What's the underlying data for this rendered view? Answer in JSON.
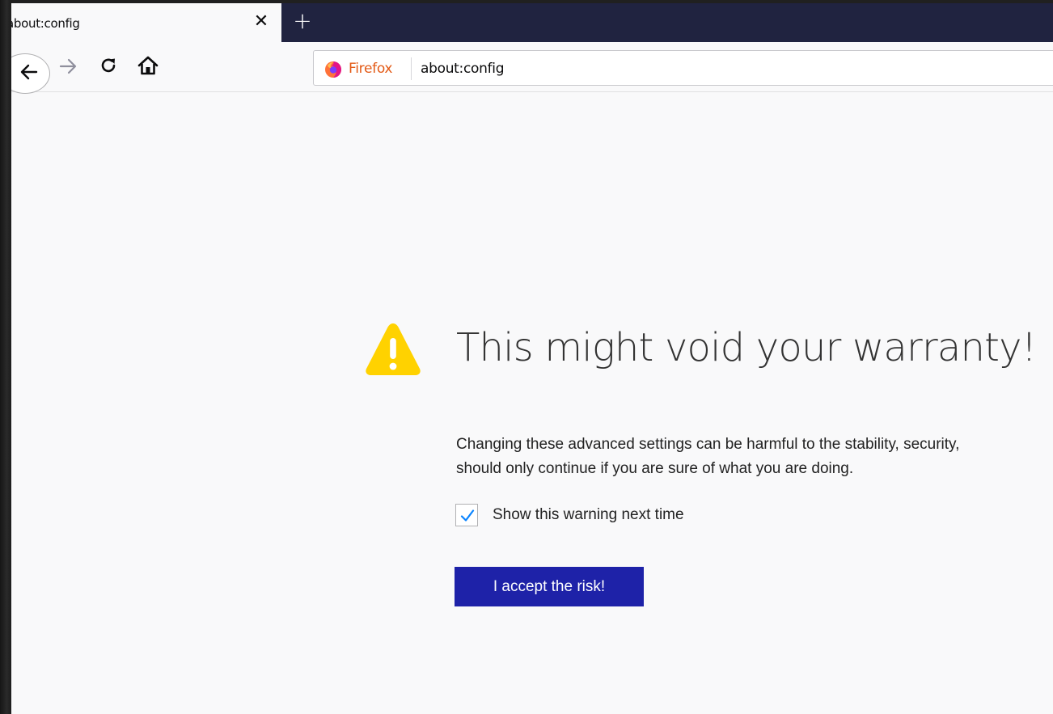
{
  "tab": {
    "title": "about:config",
    "close_glyph": "✕",
    "new_tab_glyph": "+"
  },
  "navbar": {
    "back_icon": "arrow-left-icon",
    "forward_icon": "arrow-right-icon",
    "reload_icon": "reload-icon",
    "home_icon": "home-icon"
  },
  "urlbar": {
    "identity_label": "Firefox",
    "url": "about:config"
  },
  "content": {
    "heading": "This might void your warranty!",
    "description_lines": [
      "Changing these advanced settings can be harmful to the stability, security,",
      "should only continue if you are sure of what you are doing."
    ],
    "checkbox_label": "Show this warning next time",
    "checkbox_checked": true,
    "accept_button": "I accept the risk!"
  },
  "colors": {
    "tabbar_bg": "#202340",
    "page_bg": "#f9f9fa",
    "warning_yellow": "#ffd200",
    "accept_button_bg": "#1e22a8",
    "firefox_label": "#e35a16",
    "checkmark": "#0a84ff"
  }
}
